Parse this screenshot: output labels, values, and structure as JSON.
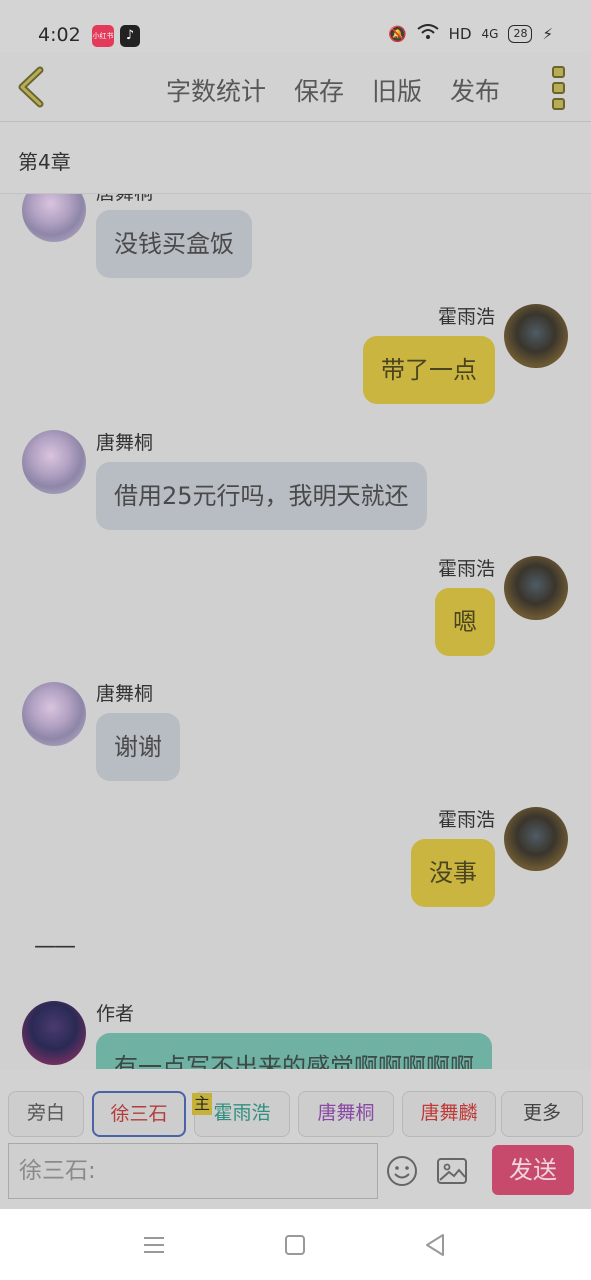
{
  "status_bar": {
    "time": "4:02",
    "app_icon_1_text": "小红书",
    "app_icon_2_text": "♪",
    "network": "HD",
    "signal": "4G",
    "battery": "28"
  },
  "header": {
    "links": [
      "字数统计",
      "保存",
      "旧版",
      "发布"
    ]
  },
  "chapter": {
    "title": "第4章"
  },
  "messages": [
    {
      "name": "唐舞桐",
      "text": "没钱买盒饭"
    },
    {
      "name": "霍雨浩",
      "text": "带了一点"
    },
    {
      "name": "唐舞桐",
      "text": "借用25元行吗，我明天就还"
    },
    {
      "name": "霍雨浩",
      "text": "嗯"
    },
    {
      "name": "唐舞桐",
      "text": "谢谢"
    },
    {
      "name": "霍雨浩",
      "text": "没事"
    },
    {
      "name": "作者",
      "text": "有一点写不出来的感觉啊啊啊啊啊"
    }
  ],
  "separator": "——",
  "chips": [
    "旁白",
    "徐三石",
    "霍雨浩",
    "唐舞桐",
    "唐舞麟",
    "更多"
  ],
  "chip_badge": "主",
  "input": {
    "placeholder": "徐三石:"
  },
  "send_label": "发送",
  "colors": {
    "gray_bubble": "#b8bcc3",
    "yellow_bubble": "#c9b540",
    "teal_bubble": "#6fb1a3",
    "send_button": "#c74a6c",
    "chip_xu": "#b43c3c",
    "chip_huo": "#2f8f80",
    "chip_tang_tong": "#8a4aa3",
    "chip_tang_lin": "#c03a3a"
  }
}
